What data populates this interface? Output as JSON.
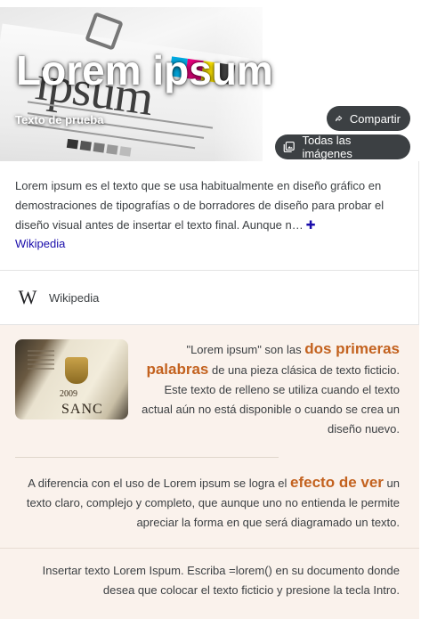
{
  "hero": {
    "title": "Lorem ipsum",
    "subtitle": "Texto de prueba",
    "share_label": "Compartir",
    "all_images_label": "Todas las imágenes",
    "photo_text": "ipsum"
  },
  "description": {
    "text": "Lorem ipsum es el texto que se usa habitualmente en diseño gráfico en demostraciones de tipografías o de borradores de diseño para probar el diseño visual antes de insertar el texto final. Aunque n…",
    "more_icon": "plus-icon",
    "source": "Wikipedia"
  },
  "source_row": {
    "label": "Wikipedia",
    "icon": "wikipedia-icon"
  },
  "snippet": {
    "thumb": {
      "year": "2009",
      "label": "SANC"
    },
    "para1": {
      "before": "\"Lorem ipsum\" son las ",
      "highlight": "dos primeras palabras",
      "after": " de una pieza clásica de texto ficticio. Este texto de relleno se utiliza cuando el texto actual aún no está disponible o cuando se crea un diseño nuevo."
    },
    "para2": {
      "before": "A diferencia con el uso de Lorem ipsum se logra el ",
      "highlight": "efecto de ver",
      "after": " un texto claro, complejo y completo, que aunque uno no entienda le permite apreciar la forma en que será diagramado un texto."
    },
    "para3": {
      "text": "Insertar texto Lorem Ispum. Escriba =lorem() en su documento donde desea que colocar el texto ficticio y presione la tecla Intro."
    }
  },
  "colors": {
    "pill_bg": "#3c4043",
    "link": "#1a0dab",
    "highlight": "#c3621f",
    "snippet_bg": "#faf2ec"
  }
}
